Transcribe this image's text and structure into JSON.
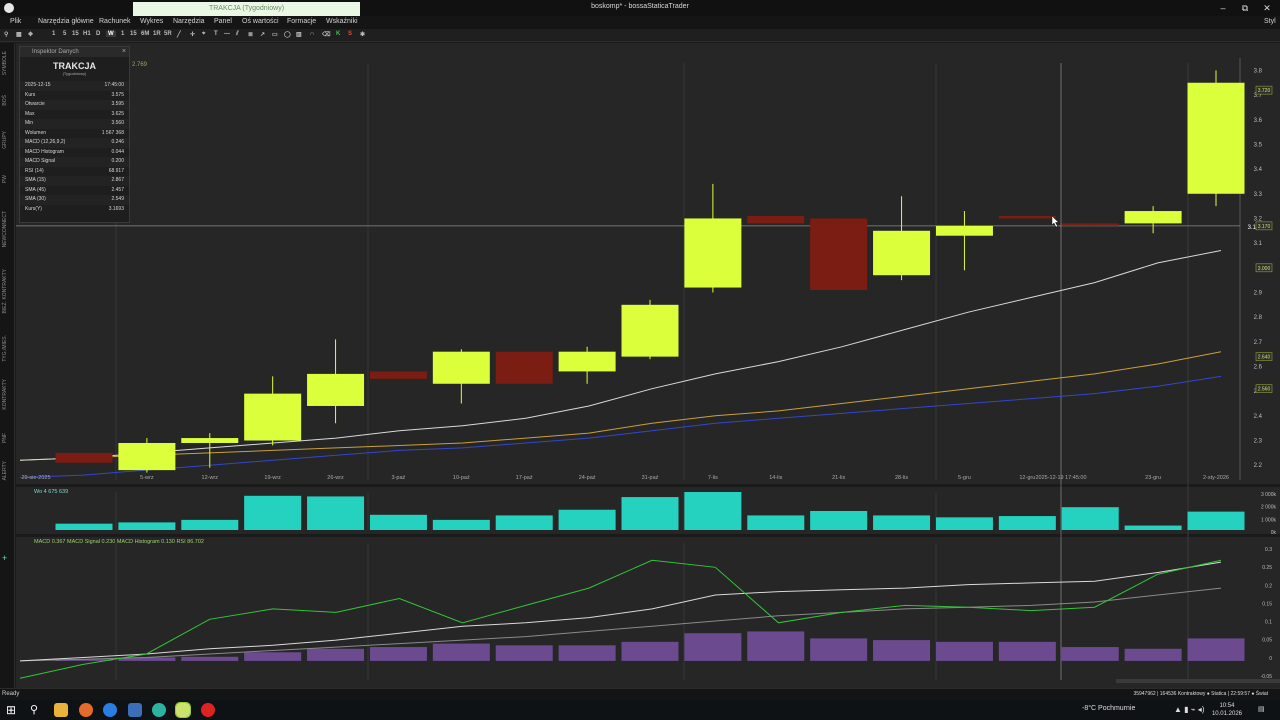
{
  "window": {
    "title": "boskomp* - bossaStaticaTrader",
    "tab_title": "TRAKCJA (Tygodniowy)",
    "controls": [
      "–",
      "⧉",
      "✕"
    ]
  },
  "menu": [
    "Plik",
    "Narzędzia główne",
    "Rachunek",
    "Wykres",
    "Narzędzia",
    "Panel",
    "Oś wartości",
    "Formacje",
    "Wskaźniki"
  ],
  "menu_right": "Styl",
  "toolbar": [
    "1",
    "5",
    "15",
    "H1",
    "D",
    "W",
    "1",
    "15",
    "6M",
    "1R",
    "5R"
  ],
  "left_strip": [
    "SYMBOLE",
    "BOŚ",
    "GRUPY",
    "PW",
    "NEWCONNECT",
    "BIEŻ. KONTRAKTY",
    "TYG./MIES.",
    "KONTRAKTY",
    "PNF",
    "ALERTY"
  ],
  "inspector": {
    "header": "Inspektor Danych",
    "name": "TRAKCJA",
    "subtitle": "(Tygodniowy)",
    "rows": [
      {
        "label": "2025-12-15",
        "value": "17:45:00"
      },
      {
        "label": "Kurs",
        "value": "3.575"
      },
      {
        "label": "Otwarcie",
        "value": "3.595"
      },
      {
        "label": "Max",
        "value": "3.625"
      },
      {
        "label": "Min",
        "value": "3.560"
      },
      {
        "label": "Wolumen",
        "value": "1 567 368"
      },
      {
        "label": "MACD (12,26,9,2)",
        "value": "0.246"
      },
      {
        "label": "MACD Histogram",
        "value": "0.044"
      },
      {
        "label": "MACD Signal",
        "value": "0.200"
      },
      {
        "label": "RSI (14)",
        "value": "68.917"
      },
      {
        "label": "SMA (15)",
        "value": "2.867"
      },
      {
        "label": "SMA (45)",
        "value": "2.457"
      },
      {
        "label": "SMA (30)",
        "value": "2.549"
      },
      {
        "label": "Kurs(Y)",
        "value": "3.1693"
      }
    ]
  },
  "chart_data": {
    "type": "candlestick",
    "x_labels": [
      "29-sie-2025",
      "5-wrz",
      "12-wrz",
      "19-wrz",
      "26-wrz",
      "3-paź",
      "10-paź",
      "17-paź",
      "24-paź",
      "31-paź",
      "7-lis",
      "14-lis",
      "21-lis",
      "28-lis",
      "5-gru",
      "12-gru",
      "2025-12-19 17:45:00",
      "23-gru",
      "2-sty-2026"
    ],
    "y_ticks": [
      2.2,
      2.3,
      2.4,
      2.5,
      2.6,
      2.7,
      2.8,
      2.9,
      3.0,
      3.1,
      3.2,
      3.3,
      3.4,
      3.5,
      3.6,
      3.7,
      3.8
    ],
    "y_range": [
      2.14,
      3.83
    ],
    "top_label": "2.769",
    "crosshair_value": "3.1704",
    "candles": [
      {
        "o": 2.25,
        "c": 2.21,
        "h": 2.25,
        "l": 2.21
      },
      {
        "o": 2.18,
        "c": 2.29,
        "h": 2.31,
        "l": 2.17
      },
      {
        "o": 2.29,
        "c": 2.31,
        "h": 2.33,
        "l": 2.19
      },
      {
        "o": 2.3,
        "c": 2.49,
        "h": 2.56,
        "l": 2.28
      },
      {
        "o": 2.44,
        "c": 2.57,
        "h": 2.71,
        "l": 2.37
      },
      {
        "o": 2.58,
        "c": 2.55,
        "h": 2.58,
        "l": 2.55
      },
      {
        "o": 2.53,
        "c": 2.66,
        "h": 2.67,
        "l": 2.45
      },
      {
        "o": 2.66,
        "c": 2.53,
        "h": 2.66,
        "l": 2.53
      },
      {
        "o": 2.58,
        "c": 2.66,
        "h": 2.68,
        "l": 2.53
      },
      {
        "o": 2.64,
        "c": 2.85,
        "h": 2.87,
        "l": 2.63
      },
      {
        "o": 2.92,
        "c": 3.2,
        "h": 3.34,
        "l": 2.9
      },
      {
        "o": 3.21,
        "c": 3.18,
        "h": 3.21,
        "l": 3.18
      },
      {
        "o": 3.2,
        "c": 2.91,
        "h": 3.2,
        "l": 2.91
      },
      {
        "o": 2.97,
        "c": 3.15,
        "h": 3.29,
        "l": 2.95
      },
      {
        "o": 3.13,
        "c": 3.17,
        "h": 3.23,
        "l": 2.99
      },
      {
        "o": 3.21,
        "c": 3.2,
        "h": 3.21,
        "l": 3.2
      },
      {
        "o": 3.18,
        "c": 3.17,
        "h": 3.18,
        "l": 3.17
      },
      {
        "o": 3.18,
        "c": 3.23,
        "h": 3.25,
        "l": 3.14
      },
      {
        "o": 3.3,
        "c": 3.75,
        "h": 3.8,
        "l": 3.25
      }
    ],
    "sma_white": [
      2.22,
      2.23,
      2.25,
      2.27,
      2.29,
      2.31,
      2.34,
      2.36,
      2.39,
      2.44,
      2.51,
      2.57,
      2.62,
      2.68,
      2.75,
      2.82,
      2.88,
      2.94,
      3.02,
      3.07
    ],
    "sma_orange": [
      2.22,
      2.23,
      2.24,
      2.25,
      2.26,
      2.27,
      2.28,
      2.29,
      2.31,
      2.33,
      2.37,
      2.4,
      2.42,
      2.45,
      2.48,
      2.51,
      2.54,
      2.57,
      2.61,
      2.66
    ],
    "sma_blue": [
      2.15,
      2.16,
      2.18,
      2.2,
      2.22,
      2.24,
      2.26,
      2.27,
      2.29,
      2.31,
      2.34,
      2.37,
      2.39,
      2.41,
      2.43,
      2.45,
      2.47,
      2.49,
      2.52,
      2.56
    ],
    "price_badges": [
      {
        "value": "3.720",
        "y": 3.72
      },
      {
        "value": "3.170",
        "y": 3.17
      },
      {
        "value": "3.000",
        "y": 3.0
      },
      {
        "value": "2.640",
        "y": 2.64
      },
      {
        "value": "2.560",
        "y": 2.51
      }
    ],
    "volume": {
      "label": "Wo 4 675 639",
      "y_ticks": [
        "3 000k",
        "2 000k",
        "1 000k",
        "0k"
      ],
      "y_max": 3000,
      "values": [
        500,
        600,
        800,
        2700,
        2650,
        1200,
        800,
        1150,
        1600,
        2600,
        3000,
        1150,
        1500,
        1150,
        1000,
        1100,
        1800,
        350,
        1450
      ]
    },
    "macd": {
      "label": "MACD 0.367 MACD Signal 0.230 MACD Histogram 0.130 RSI 86.702",
      "y_ticks": [
        "0.3",
        "0.25",
        "0.2",
        "0.15",
        "0.1",
        "0.05",
        "0",
        "-0.05"
      ],
      "y_range": [
        -0.055,
        0.34
      ],
      "histogram": [
        0.005,
        0.01,
        0.012,
        0.025,
        0.035,
        0.04,
        0.05,
        0.045,
        0.045,
        0.055,
        0.08,
        0.085,
        0.065,
        0.06,
        0.055,
        0.055,
        0.04,
        0.035,
        0.065
      ],
      "green": [
        -0.05,
        -0.01,
        0.02,
        0.12,
        0.15,
        0.14,
        0.18,
        0.11,
        0.16,
        0.21,
        0.29,
        0.27,
        0.11,
        0.14,
        0.16,
        0.155,
        0.145,
        0.155,
        0.25,
        0.29
      ],
      "white": [
        0.0,
        0.01,
        0.02,
        0.035,
        0.045,
        0.06,
        0.08,
        0.1,
        0.11,
        0.125,
        0.15,
        0.19,
        0.2,
        0.205,
        0.21,
        0.22,
        0.225,
        0.23,
        0.255,
        0.285
      ],
      "gray": [
        0.0,
        0.005,
        0.01,
        0.02,
        0.03,
        0.04,
        0.05,
        0.06,
        0.07,
        0.085,
        0.1,
        0.115,
        0.13,
        0.14,
        0.15,
        0.155,
        0.16,
        0.17,
        0.19,
        0.21
      ]
    }
  },
  "status": {
    "left": "Ready",
    "right": "35947962 | 164536 Kontraktowy   ●  Statica | 22:59:57   ●  Świat"
  },
  "taskbar": {
    "weather": "-8°C  Pochmurnie",
    "time": "10:54",
    "date": "10.01.2026"
  },
  "colors": {
    "bull": "#dbff3a",
    "bear": "#7b1d12",
    "volume": "#25d2c0",
    "hist": "#6b4a8f",
    "sma_white": "#d9d9d9",
    "sma_orange": "#c9a13a",
    "sma_blue": "#3446c9",
    "macd_green": "#33c43a"
  }
}
